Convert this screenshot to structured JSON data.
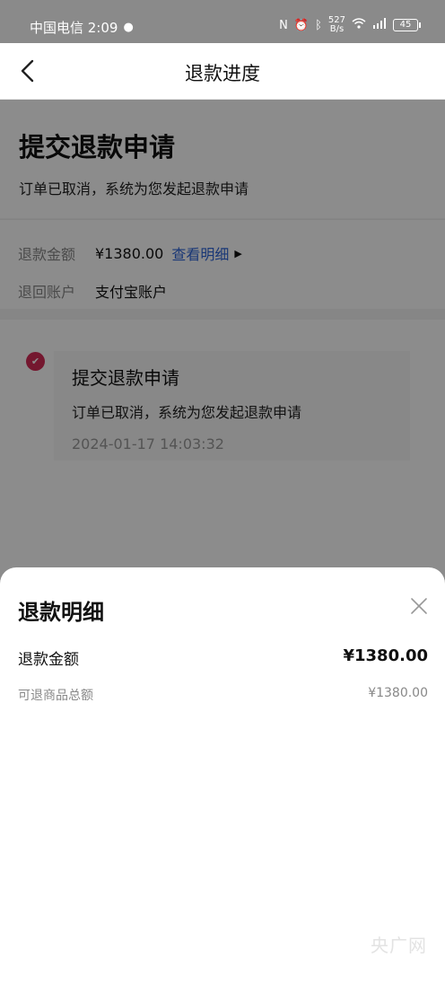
{
  "status_bar": {
    "carrier_time": "中国电信 2:09",
    "net_speed_value": "527",
    "net_speed_unit": "B/s",
    "battery": "45"
  },
  "nav": {
    "title": "退款进度"
  },
  "refund_status": {
    "title": "提交退款申请",
    "desc": "订单已取消，系统为您发起退款申请"
  },
  "info": {
    "amount_label": "退款金额",
    "amount_value": "¥1380.00",
    "detail_link": "查看明细",
    "account_label": "退回账户",
    "account_value": "支付宝账户"
  },
  "timeline": [
    {
      "title": "提交退款申请",
      "desc": "订单已取消，系统为您发起退款申请",
      "time": "2024-01-17 14:03:32"
    }
  ],
  "sheet": {
    "title": "退款明细",
    "main_label": "退款金额",
    "main_value": "¥1380.00",
    "sub_label": "可退商品总额",
    "sub_value": "¥1380.00"
  },
  "watermark": "央广网",
  "colors": {
    "accent": "#d42a57",
    "link": "#2f64d8"
  }
}
